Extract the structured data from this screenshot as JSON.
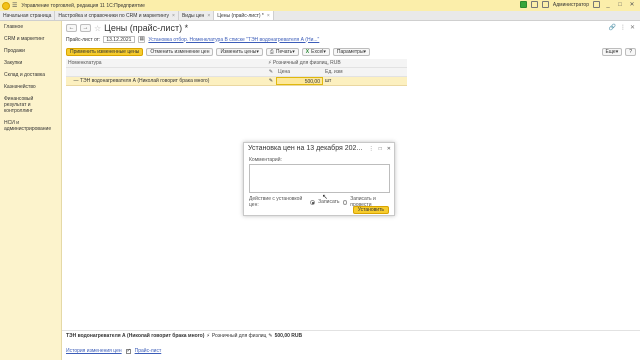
{
  "titlebar": {
    "menu_icon": "hamburger-icon",
    "title": "Управление торговлей, редакция 11 1С:Предприятие",
    "user": "Администратор"
  },
  "tabs": [
    {
      "label": "Начальная страница"
    },
    {
      "label": "Настройка и справочники по CRM и маркетингу"
    },
    {
      "label": "Виды цен"
    },
    {
      "label": "Цены (прайс-лист) *"
    }
  ],
  "sidebar": {
    "items": [
      "Главное",
      "CRM и маркетинг",
      "Продажи",
      "Закупки",
      "Склад и доставка",
      "Казначейство",
      "Финансовый результат и контроллинг",
      "НСИ и администрирование"
    ]
  },
  "document": {
    "title": "Цены (прайс-лист) *",
    "date_label": "Прайс-лист от:",
    "date_value": "13.12.2021",
    "link_text": "Установка отбор. Номенклатура В списке \"ТЭН водонагревателя А (Ни...\""
  },
  "toolbar": {
    "apply": "Применить измененные цены",
    "cancel": "Отменить изменение цен",
    "change": "Изменить цены",
    "print": "Печать",
    "excel": "Excel",
    "params": "Параметры",
    "more": "Еще"
  },
  "grid": {
    "col_nom": "Номенклатура",
    "col_price_type": "Розничный для физлиц, RUB",
    "col_price": "Цена",
    "col_unit": "Ед. изм",
    "rows": [
      {
        "name": "ТЭН водонагревателя А (Николай говорит брака много)",
        "price": "500,00",
        "unit": "шт"
      }
    ]
  },
  "dialog": {
    "title": "Установка цен на 13 декабря 202...",
    "comment_label": "Комментарий:",
    "action_label": "Действие с установкой цен:",
    "opt_record": "Записать",
    "opt_record_post": "Записать и провести",
    "ok": "Установить"
  },
  "footer": {
    "item": "ТЭН водонагревателя А (Николай говорит брака много)",
    "price_type": "Розничный для физлиц",
    "price": "500,00 RUB",
    "history": "История изменения цен",
    "price_list": "Прайс-лист"
  }
}
